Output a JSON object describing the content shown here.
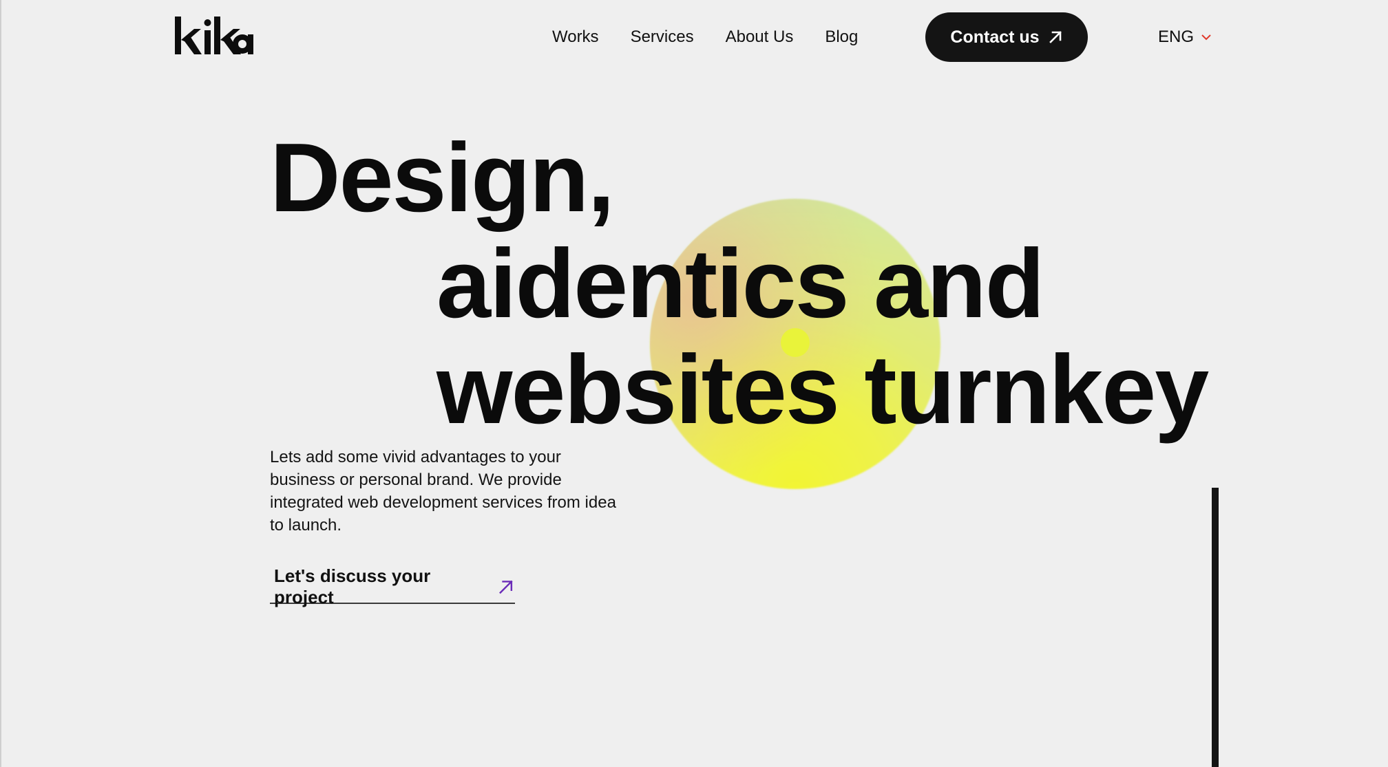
{
  "header": {
    "logo_text": "kika",
    "nav": [
      "Works",
      "Services",
      "About Us",
      "Blog"
    ],
    "contact_label": "Contact us",
    "language": "ENG"
  },
  "hero": {
    "headline_lines": [
      "Design,",
      "aidentics and",
      "websites turnkey"
    ],
    "intro": "Lets add some vivid advantages to your business or personal brand. We provide integrated web development services from idea to launch.",
    "cta_label": "Let's discuss your project"
  },
  "colors": {
    "background": "#efefef",
    "text": "#0e0e0e",
    "button": "#141414",
    "accent_arrow": "#6a2bb8",
    "chevron": "#e0392b",
    "blob_yellow": "#eef24a",
    "blob_green": "#cfe6a3",
    "blob_peach": "#ecb896"
  },
  "icons": {
    "contact_arrow": "arrow-up-right-icon",
    "language_chevron": "chevron-down-icon",
    "cta_arrow": "arrow-up-right-icon"
  }
}
